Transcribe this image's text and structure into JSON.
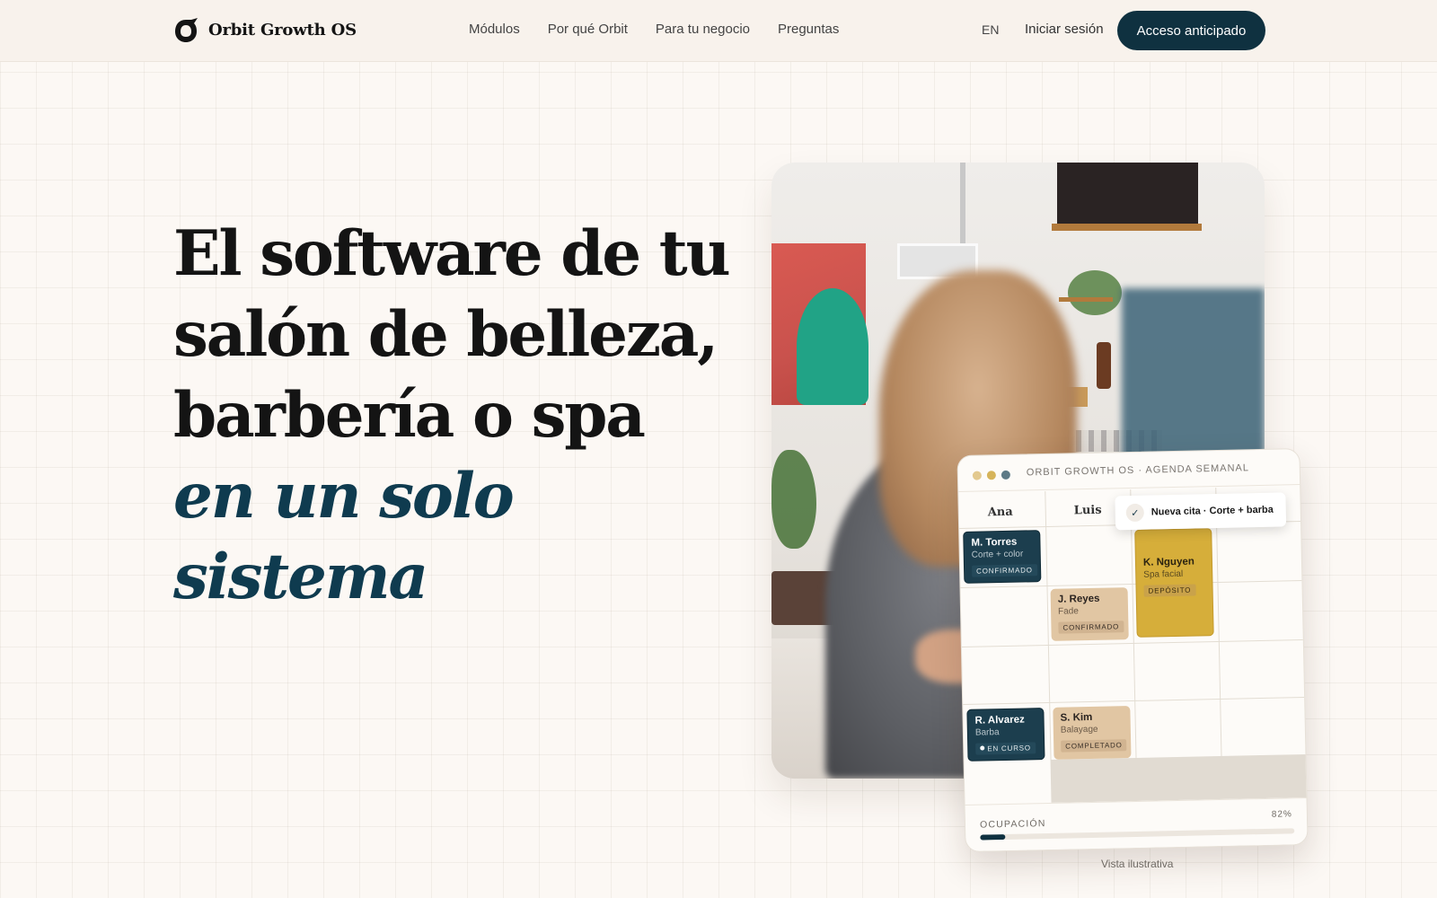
{
  "brand": {
    "name": "Orbit Growth OS",
    "logo_icon": "orbit-logo-icon"
  },
  "nav": {
    "links": [
      "Módulos",
      "Por qué Orbit",
      "Para tu negocio",
      "Preguntas"
    ],
    "lang": "EN",
    "login": "Iniciar sesión",
    "cta": "Acceso anticipado"
  },
  "hero": {
    "title_plain": "El software de tu salón de belleza, barbería o spa",
    "title_accent": "en un solo sistema"
  },
  "schedule": {
    "title": "ORBIT GROWTH OS · AGENDA SEMANAL",
    "columns": [
      "Ana",
      "Luis"
    ],
    "toast": "Nueva cita · Corte + barba",
    "appointments": [
      {
        "name": "M. Torres",
        "service": "Corte + color",
        "status": "CONFIRMADO"
      },
      {
        "name": "J. Reyes",
        "service": "Fade",
        "status": "CONFIRMADO"
      },
      {
        "name": "K. Nguyen",
        "service": "Spa facial",
        "status": "DEPÓSITO"
      },
      {
        "name": "R. Alvarez",
        "service": "Barba",
        "status": "EN CURSO"
      },
      {
        "name": "S. Kim",
        "service": "Balayage",
        "status": "COMPLETADO"
      }
    ],
    "occupancy_label": "OCUPACIÓN",
    "occupancy_value": "82%",
    "occupancy_fraction": 0.08
  },
  "caption": "Vista ilustrativa",
  "colors": {
    "accent": "#0f3b4f",
    "cta_bg": "#0f3140",
    "gold": "#d6ae3a",
    "tan": "#e1c6a3",
    "dots": [
      "#e3c98f",
      "#d6b45a",
      "#5d7a86"
    ]
  }
}
